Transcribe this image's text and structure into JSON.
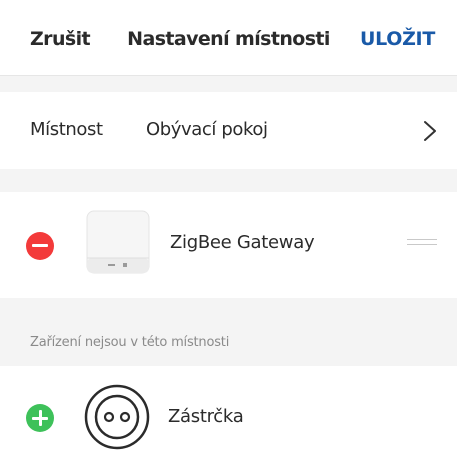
{
  "header": {
    "cancel_label": "Zrušit",
    "title": "Nastavení místnosti",
    "save_label": "ULOŽIT"
  },
  "room": {
    "label": "Místnost",
    "value": "Obývací pokoj",
    "chevron_icon": "chevron-right-icon"
  },
  "devices_in_room": [
    {
      "name": "ZigBee Gateway",
      "action_icon": "remove-circle-icon",
      "image_icon": "gateway-device-icon",
      "handle_icon": "drag-handle-icon"
    }
  ],
  "other_section": {
    "title": "Zařízení nejsou v této místnosti"
  },
  "devices_not_in_room": [
    {
      "name": "Zástrčka",
      "action_icon": "add-circle-icon",
      "image_icon": "socket-plug-icon"
    }
  ],
  "colors": {
    "accent": "#1a5aa8",
    "remove": "#f33a3a",
    "add": "#3ec15a",
    "background": "#f4f4f4"
  }
}
